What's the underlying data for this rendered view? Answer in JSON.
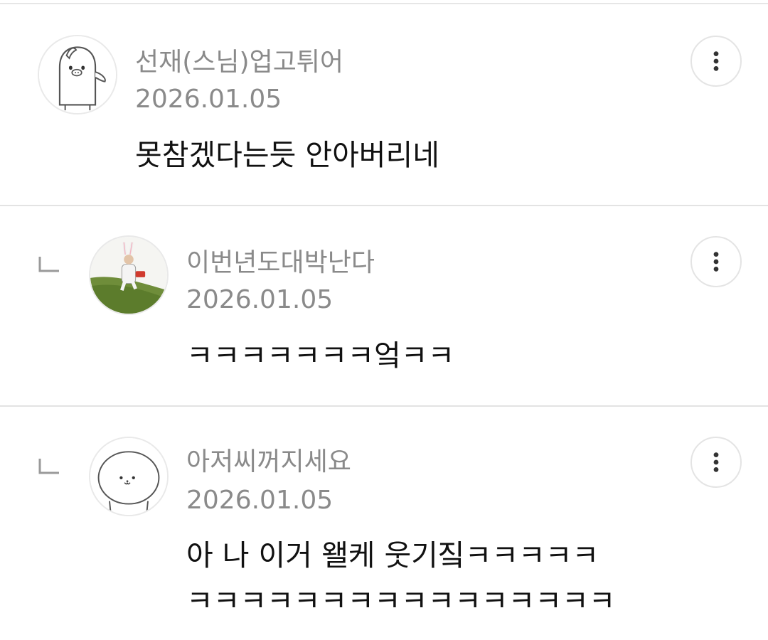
{
  "comments": [
    {
      "username": "선재(스님)업고튀어",
      "date": "2026.01.05",
      "text_lines": [
        "못참겠다는듯 안아버리네"
      ],
      "is_reply": false,
      "avatar_icon": "penguin-character-icon",
      "more_icon": "more-vertical-icon"
    },
    {
      "username": "이번년도대박난다",
      "date": "2026.01.05",
      "text_lines": [
        "ㅋㅋㅋㅋㅋㅋㅋ엌ㅋㅋ"
      ],
      "is_reply": true,
      "avatar_icon": "profile-photo",
      "more_icon": "more-vertical-icon"
    },
    {
      "username": "아저씨꺼지세요",
      "date": "2026.01.05",
      "text_lines": [
        "아 나 이거 왤케 웃기짘ㅋㅋㅋㅋㅋ",
        "ㅋㅋㅋㅋㅋㅋㅋㅋㅋㅋㅋㅋㅋㅋㅋㅋ"
      ],
      "is_reply": true,
      "avatar_icon": "seal-character-icon",
      "more_icon": "more-vertical-icon"
    }
  ],
  "colors": {
    "meta_text": "#8a8a8a",
    "body_text": "#111111",
    "divider": "#e3e3e3"
  }
}
